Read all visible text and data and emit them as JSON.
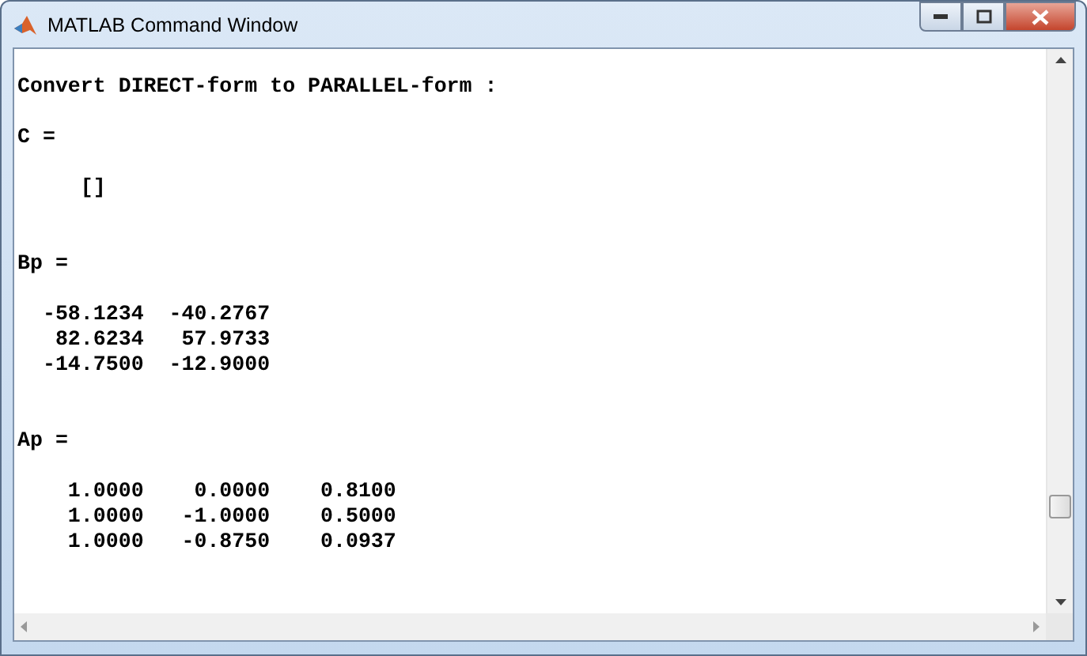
{
  "window": {
    "title": "MATLAB Command Window"
  },
  "lines": [
    {
      "kind": "blank"
    },
    {
      "kind": "output",
      "text": "Convert DIRECT-form to PARALLEL-form :"
    },
    {
      "kind": "blank"
    },
    {
      "kind": "output",
      "text": "C ="
    },
    {
      "kind": "blank"
    },
    {
      "kind": "output",
      "text": "     []"
    },
    {
      "kind": "blank"
    },
    {
      "kind": "blank"
    },
    {
      "kind": "output",
      "text": "Bp ="
    },
    {
      "kind": "blank"
    },
    {
      "kind": "output",
      "text": "  -58.1234  -40.2767"
    },
    {
      "kind": "output",
      "text": "   82.6234   57.9733"
    },
    {
      "kind": "output",
      "text": "  -14.7500  -12.9000"
    },
    {
      "kind": "blank"
    },
    {
      "kind": "blank"
    },
    {
      "kind": "output",
      "text": "Ap ="
    },
    {
      "kind": "blank"
    },
    {
      "kind": "output",
      "text": "    1.0000    0.0000    0.8100"
    },
    {
      "kind": "output",
      "text": "    1.0000   -1.0000    0.5000"
    },
    {
      "kind": "output",
      "text": "    1.0000   -0.8750    0.0937"
    }
  ]
}
